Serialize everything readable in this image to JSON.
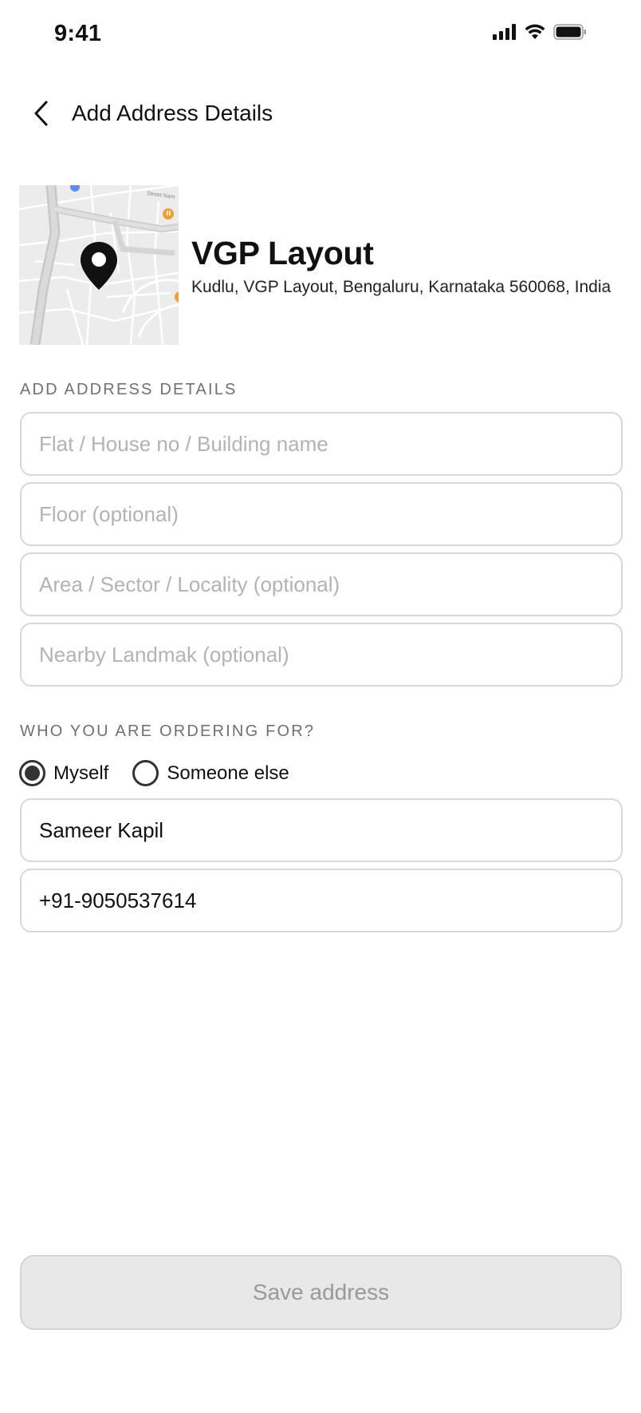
{
  "status_bar": {
    "time": "9:41"
  },
  "header": {
    "title": "Add Address Details"
  },
  "location": {
    "name": "VGP Layout",
    "address": "Kudlu, VGP Layout, Bengaluru, Karnataka 560068, India",
    "map_street_label": "Street Nam"
  },
  "address_section": {
    "label": "ADD ADDRESS DETAILS",
    "fields": [
      {
        "placeholder": "Flat / House no / Building name",
        "value": ""
      },
      {
        "placeholder": "Floor (optional)",
        "value": ""
      },
      {
        "placeholder": "Area / Sector / Locality (optional)",
        "value": ""
      },
      {
        "placeholder": "Nearby Landmak (optional)",
        "value": ""
      }
    ]
  },
  "ordering_section": {
    "label": "WHO YOU ARE  ORDERING FOR?",
    "options": [
      {
        "label": "Myself",
        "selected": true
      },
      {
        "label": "Someone else",
        "selected": false
      }
    ],
    "name_value": "Sameer Kapil",
    "phone_value": "+91-9050537614"
  },
  "footer": {
    "save_label": "Save address"
  },
  "colors": {
    "accent": "#333333",
    "muted_text": "#707070",
    "placeholder": "#b3b3b3",
    "disabled_button": "#e8e8e8"
  },
  "icons": [
    "back-chevron-icon",
    "signal-icon",
    "wifi-icon",
    "battery-icon",
    "location-pin-icon"
  ]
}
